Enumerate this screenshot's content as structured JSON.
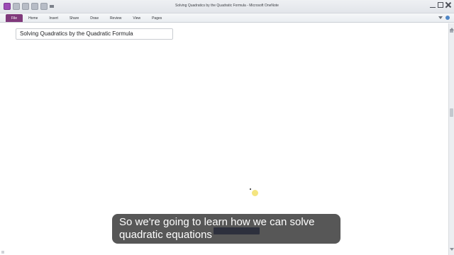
{
  "window": {
    "title": "Solving Quadratics by the Quadratic Formula - Microsoft OneNote"
  },
  "ribbon": {
    "tabs": [
      "File",
      "Home",
      "Insert",
      "Share",
      "Draw",
      "Review",
      "View",
      "Pages"
    ]
  },
  "page": {
    "title": "Solving Quadratics by the Quadratic Formula"
  },
  "caption": {
    "line1": "So we're going to learn how we can solve",
    "line2": "quadratic equations"
  },
  "colors": {
    "file_tab": "#80397b",
    "caption_background": "#282828"
  },
  "icons": [
    "onenote-icon",
    "save-icon",
    "undo-icon",
    "minimize-icon",
    "maximize-icon",
    "close-icon",
    "help-icon"
  ]
}
